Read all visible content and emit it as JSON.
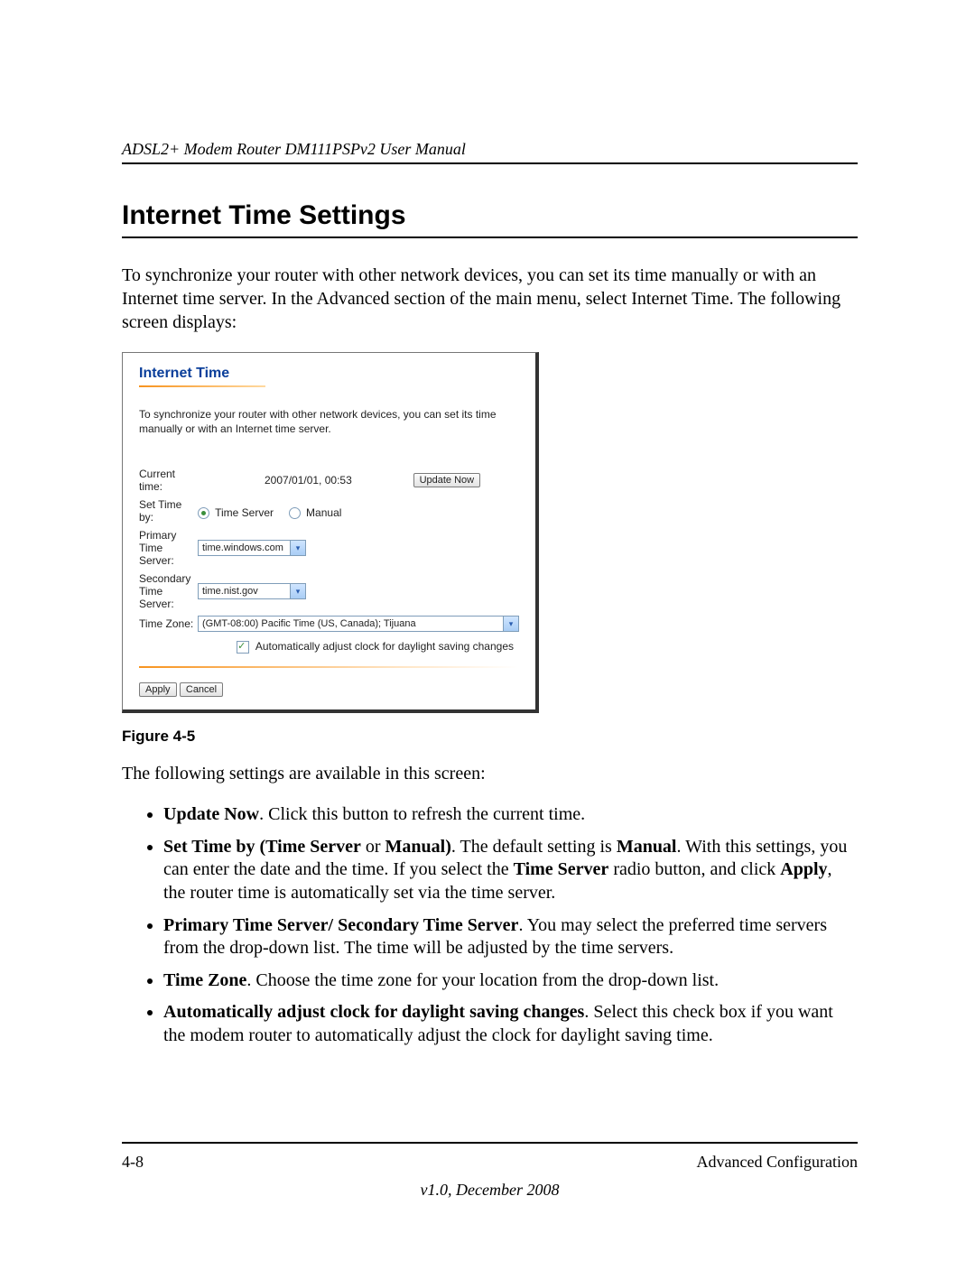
{
  "header": {
    "running_title": "ADSL2+ Modem Router DM111PSPv2 User Manual"
  },
  "section": {
    "title": "Internet Time Settings",
    "intro": "To synchronize your router with other network devices, you can set its time manually or with an Internet time server. In the Advanced section of the main menu, select Internet Time. The following screen displays:"
  },
  "screenshot": {
    "panel_title": "Internet Time",
    "intro": "To synchronize your router with other network devices, you can set its time manually or with an Internet time server.",
    "current_time_label": "Current time:",
    "current_time_value": "2007/01/01, 00:53",
    "update_now_btn": "Update Now",
    "set_time_by_label": "Set Time by:",
    "radio_time_server": "Time Server",
    "radio_manual": "Manual",
    "primary_label": "Primary Time Server:",
    "primary_value": "time.windows.com",
    "secondary_label": "Secondary Time Server:",
    "secondary_value": "time.nist.gov",
    "timezone_label": "Time Zone:",
    "timezone_value": "(GMT-08:00) Pacific Time (US, Canada); Tijuana",
    "dst_checkbox": "Automatically adjust clock for daylight saving changes",
    "apply_btn": "Apply",
    "cancel_btn": "Cancel"
  },
  "figure_caption": "Figure 4-5",
  "after_figure": "The following settings are available in this screen:",
  "bullets": {
    "b1_bold": "Update Now",
    "b1_rest": ". Click this button to refresh the current time.",
    "b2_bold_a": "Set Time by (Time Server",
    "b2_or": " or ",
    "b2_bold_b": "Manual)",
    "b2_mid1": ". The default setting is ",
    "b2_bold_c": "Manual",
    "b2_mid2": ". With this settings, you can enter the date and the time. If you select the ",
    "b2_bold_d": "Time Server",
    "b2_mid3": " radio button, and click ",
    "b2_bold_e": "Apply",
    "b2_tail": ", the router time is automatically set via the time server.",
    "b3_bold": "Primary Time Server/ Secondary Time Server",
    "b3_rest": ". You may select the preferred time servers from the drop-down list. The time will be adjusted by the time servers.",
    "b4_bold": "Time Zone",
    "b4_rest": ". Choose the time zone for your location from the drop-down list.",
    "b5_bold": "Automatically adjust clock for daylight saving changes",
    "b5_rest": ". Select this check box if you want the modem router to automatically adjust the clock for daylight saving time."
  },
  "footer": {
    "page_number": "4-8",
    "section_name": "Advanced Configuration",
    "version": "v1.0, December 2008"
  }
}
